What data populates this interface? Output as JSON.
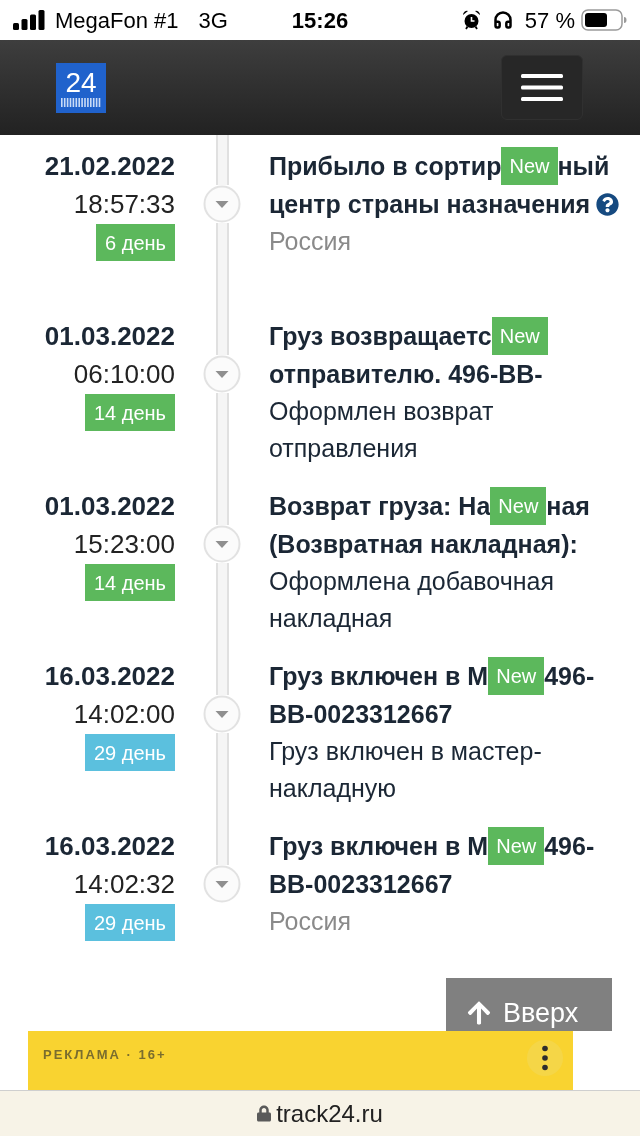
{
  "status_bar": {
    "carrier": "MegaFon #1",
    "network": "3G",
    "time": "15:26",
    "battery": "57 %"
  },
  "header": {
    "logo_text": "24"
  },
  "events": [
    {
      "date": "21.02.2022",
      "time": "18:57:33",
      "day": "6 день",
      "color": "#5cb85c",
      "title_start": "Прибыло в сортир",
      "badge": "New",
      "title_end": "ный",
      "title_continuation": "центр страны назначения",
      "help_icon": true,
      "location": "Россия"
    },
    {
      "date": "01.03.2022",
      "time": "06:10:00",
      "day": "14 день",
      "color": "#5cb85c",
      "title_start": "Груз возвращаетс",
      "badge": "New",
      "title_continuation": "отправителю. 496-BB-",
      "help_icon": false,
      "details": "Оформлен возврат отправления"
    },
    {
      "date": "01.03.2022",
      "time": "15:23:00",
      "day": "14 день",
      "color": "#5cb85c",
      "title_start": "Возврат груза: На",
      "badge": "New",
      "title_end": "ная",
      "title_continuation": "(Возвратная накладная):",
      "help_icon": false,
      "details": "Оформлена добавочная накладная"
    },
    {
      "date": "16.03.2022",
      "time": "14:02:00",
      "day": "29 день",
      "color": "#5bc0de",
      "title_start": "Груз включен в M",
      "badge": "New",
      "title_end": "496-",
      "title_continuation": "BB-0023312667",
      "help_icon": false,
      "details": "Груз включен в мастер-накладную"
    },
    {
      "date": "16.03.2022",
      "time": "14:02:32",
      "day": "29 день",
      "color": "#5bc0de",
      "title_start": "Груз включен в M",
      "badge": "New",
      "title_end": "496-",
      "title_continuation": "BB-0023312667",
      "help_icon": false,
      "location": "Россия"
    }
  ],
  "scroll_top_button": {
    "label": "Вверх"
  },
  "ad": {
    "label": "РЕКЛАМА · 16+"
  },
  "browser_bar": {
    "url": "track24.ru"
  }
}
